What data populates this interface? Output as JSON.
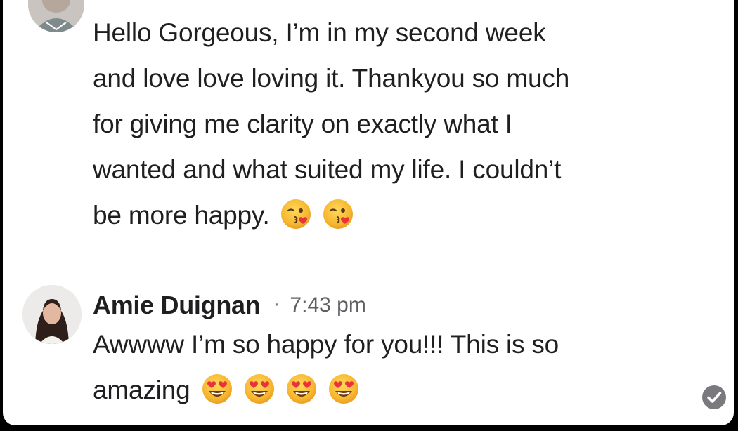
{
  "comments": [
    {
      "author": "",
      "text_lines": [
        "Hello Gorgeous, I’m in my second week",
        "and love love loving it. Thankyou so much",
        "for giving me clarity on exactly what I",
        "wanted and what suited my life. I couldn’t",
        "be more happy."
      ],
      "emojis": [
        "kissing-heart-emoji",
        "kissing-heart-emoji"
      ]
    },
    {
      "author": "Amie Duignan",
      "separator": "·",
      "time": "7:43 pm",
      "text_lines": [
        "Awwww I’m so happy for you!!! This is so",
        "amazing"
      ],
      "emojis": [
        "heart-eyes-emoji",
        "heart-eyes-emoji",
        "heart-eyes-emoji",
        "heart-eyes-emoji"
      ]
    }
  ],
  "status_icon": "check-circle-icon",
  "colors": {
    "background": "#000000",
    "card": "#ffffff",
    "text": "#1f1f21",
    "muted": "#5f5f63",
    "emoji_face": "#f8c33a",
    "emoji_heart": "#e8323c"
  }
}
